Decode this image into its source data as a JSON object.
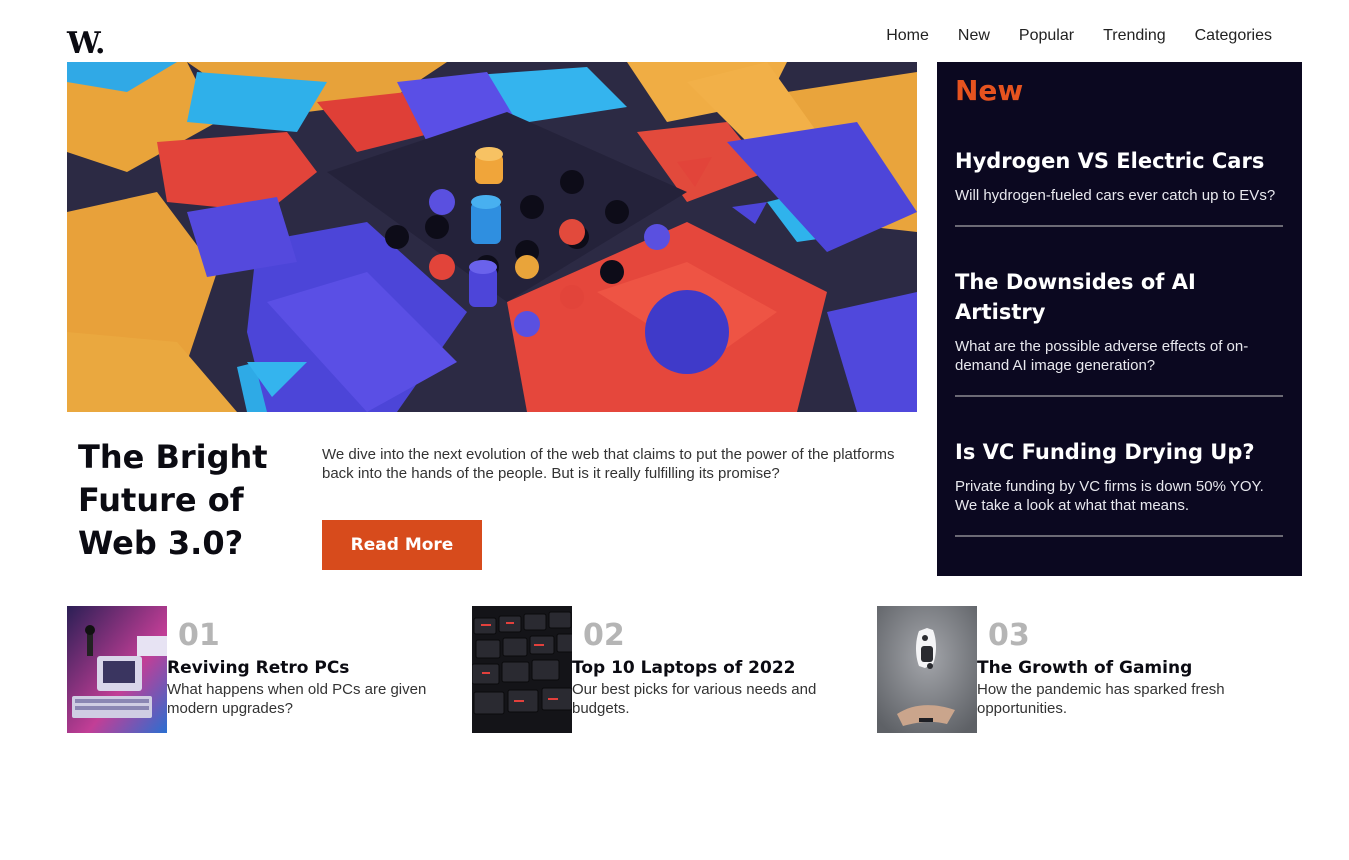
{
  "header": {
    "logo": "W.",
    "nav": [
      "Home",
      "New",
      "Popular",
      "Trending",
      "Categories"
    ]
  },
  "hero": {
    "title": "The Bright Future of Web 3.0?",
    "description": "We dive into the next evolution of the web that claims to put the power of the platforms back into the hands of the people. But is it really fulfilling its promise?",
    "button_label": "Read More"
  },
  "sidebar": {
    "heading": "New",
    "items": [
      {
        "title": "Hydrogen VS Electric Cars",
        "description": "Will hydrogen-fueled cars ever catch up to EVs?"
      },
      {
        "title": "The Downsides of AI Artistry",
        "description": "What are the possible adverse effects of on-demand AI image generation?"
      },
      {
        "title": "Is VC Funding Drying Up?",
        "description": "Private funding by VC firms is down 50% YOY. We take a look at what that means."
      }
    ]
  },
  "cards": [
    {
      "number": "01",
      "title": "Reviving Retro PCs",
      "description": "What happens when old PCs are given modern upgrades?"
    },
    {
      "number": "02",
      "title": "Top 10 Laptops of 2022",
      "description": "Our best picks for various needs and budgets."
    },
    {
      "number": "03",
      "title": "The Growth of Gaming",
      "description": "How the pandemic has sparked fresh opportunities."
    }
  ],
  "colors": {
    "accent": "#d74b1c",
    "sidebar_bg": "#0b0820",
    "number_gray": "#b5b5b5"
  }
}
